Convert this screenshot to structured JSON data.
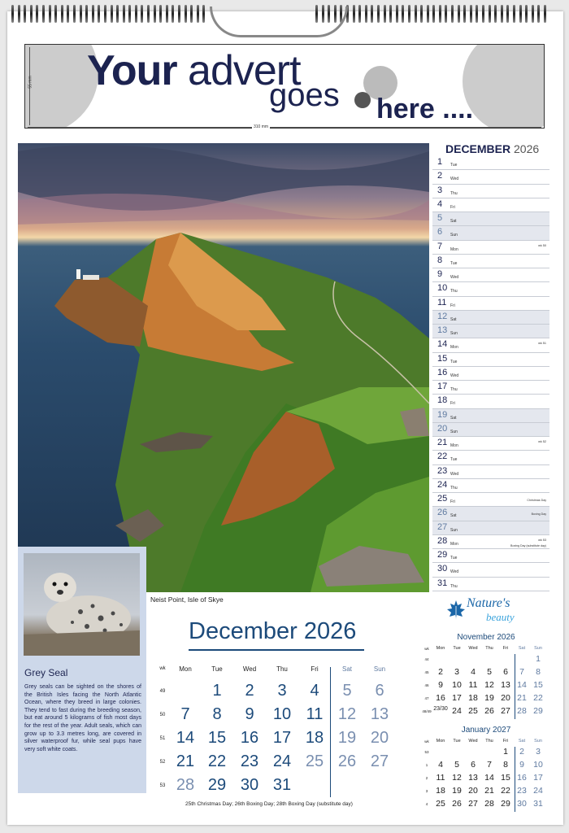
{
  "advert": {
    "line1_a": "Your",
    "line1_b": "advert",
    "line2": "goes",
    "line3": "here ....",
    "width_label": "310 mm",
    "height_label": "55 mm"
  },
  "photo": {
    "caption": "Neist Point, Isle of Skye"
  },
  "seal": {
    "title": "Grey Seal",
    "text": "Grey seals can be sighted on the shores of the British Isles facing the North Atlantic Ocean, where they breed in large colonies. They tend to fast during the breeding season, but eat around 5 kilograms of fish most days for the rest of the year. Adult seals, which can grow up to 3.3 metres long, are covered in silver waterproof fur, while seal pups have very soft white coats."
  },
  "daylist": {
    "month": "DECEMBER",
    "year": "2026",
    "days": [
      {
        "n": "1",
        "w": "Tue",
        "we": false
      },
      {
        "n": "2",
        "w": "Wed",
        "we": false
      },
      {
        "n": "3",
        "w": "Thu",
        "we": false
      },
      {
        "n": "4",
        "w": "Fri",
        "we": false
      },
      {
        "n": "5",
        "w": "Sat",
        "we": true
      },
      {
        "n": "6",
        "w": "Sun",
        "we": true
      },
      {
        "n": "7",
        "w": "Mon",
        "we": false,
        "wk": "wk 50"
      },
      {
        "n": "8",
        "w": "Tue",
        "we": false
      },
      {
        "n": "9",
        "w": "Wed",
        "we": false
      },
      {
        "n": "10",
        "w": "Thu",
        "we": false
      },
      {
        "n": "11",
        "w": "Fri",
        "we": false
      },
      {
        "n": "12",
        "w": "Sat",
        "we": true
      },
      {
        "n": "13",
        "w": "Sun",
        "we": true
      },
      {
        "n": "14",
        "w": "Mon",
        "we": false,
        "wk": "wk 51"
      },
      {
        "n": "15",
        "w": "Tue",
        "we": false
      },
      {
        "n": "16",
        "w": "Wed",
        "we": false
      },
      {
        "n": "17",
        "w": "Thu",
        "we": false
      },
      {
        "n": "18",
        "w": "Fri",
        "we": false
      },
      {
        "n": "19",
        "w": "Sat",
        "we": true
      },
      {
        "n": "20",
        "w": "Sun",
        "we": true
      },
      {
        "n": "21",
        "w": "Mon",
        "we": false,
        "wk": "wk 52"
      },
      {
        "n": "22",
        "w": "Tue",
        "we": false
      },
      {
        "n": "23",
        "w": "Wed",
        "we": false
      },
      {
        "n": "24",
        "w": "Thu",
        "we": false
      },
      {
        "n": "25",
        "w": "Fri",
        "we": false,
        "hol": "Christmas Day"
      },
      {
        "n": "26",
        "w": "Sat",
        "we": true,
        "hol": "Boxing Day"
      },
      {
        "n": "27",
        "w": "Sun",
        "we": true
      },
      {
        "n": "28",
        "w": "Mon",
        "we": false,
        "wk": "wk 53",
        "hol2": "Boxing Day (substitute day)"
      },
      {
        "n": "29",
        "w": "Tue",
        "we": false
      },
      {
        "n": "30",
        "w": "Wed",
        "we": false
      },
      {
        "n": "31",
        "w": "Thu",
        "we": false
      }
    ]
  },
  "logo": {
    "line1": "Nature's",
    "line2": "beauty",
    "colors": {
      "blue": "#1a66a8",
      "light": "#3aa3dc"
    }
  },
  "main_month": {
    "month": "December",
    "year": "2026",
    "wk_label": "wk",
    "headers": [
      "Mon",
      "Tue",
      "Wed",
      "Thu",
      "Fri",
      "Sat",
      "Sun"
    ],
    "weeks": [
      {
        "wk": "49",
        "days": [
          "",
          "1",
          "2",
          "3",
          "4",
          "5",
          "6"
        ]
      },
      {
        "wk": "50",
        "days": [
          "7",
          "8",
          "9",
          "10",
          "11",
          "12",
          "13"
        ]
      },
      {
        "wk": "51",
        "days": [
          "14",
          "15",
          "16",
          "17",
          "18",
          "19",
          "20"
        ]
      },
      {
        "wk": "52",
        "days": [
          "21",
          "22",
          "23",
          "24",
          "25",
          "26",
          "27"
        ]
      },
      {
        "wk": "53",
        "days": [
          "28",
          "29",
          "30",
          "31",
          "",
          "",
          ""
        ]
      }
    ],
    "footnote": "25th Christmas Day; 26th Boxing Day; 28th Boxing Day (substitute day)"
  },
  "mini_nov": {
    "title": "November 2026",
    "wk_label": "wk",
    "headers": [
      "Mon",
      "Tue",
      "Wed",
      "Thu",
      "Fri",
      "Sat",
      "Sun"
    ],
    "weeks": [
      {
        "wk": "44",
        "days": [
          "",
          "",
          "",
          "",
          "",
          "",
          "1"
        ]
      },
      {
        "wk": "45",
        "days": [
          "2",
          "3",
          "4",
          "5",
          "6",
          "7",
          "8"
        ]
      },
      {
        "wk": "46",
        "days": [
          "9",
          "10",
          "11",
          "12",
          "13",
          "14",
          "15"
        ]
      },
      {
        "wk": "47",
        "days": [
          "16",
          "17",
          "18",
          "19",
          "20",
          "21",
          "22"
        ]
      },
      {
        "wk": "48/49",
        "days": [
          "23/30",
          "24",
          "25",
          "26",
          "27",
          "28",
          "29"
        ]
      }
    ]
  },
  "mini_jan": {
    "title": "January 2027",
    "wk_label": "wk",
    "headers": [
      "Mon",
      "Tue",
      "Wed",
      "Thu",
      "Fri",
      "Sat",
      "Sun"
    ],
    "weeks": [
      {
        "wk": "53",
        "days": [
          "",
          "",
          "",
          "",
          "1",
          "2",
          "3"
        ]
      },
      {
        "wk": "1",
        "days": [
          "4",
          "5",
          "6",
          "7",
          "8",
          "9",
          "10"
        ]
      },
      {
        "wk": "2",
        "days": [
          "11",
          "12",
          "13",
          "14",
          "15",
          "16",
          "17"
        ]
      },
      {
        "wk": "3",
        "days": [
          "18",
          "19",
          "20",
          "21",
          "22",
          "23",
          "24"
        ]
      },
      {
        "wk": "4",
        "days": [
          "25",
          "26",
          "27",
          "28",
          "29",
          "30",
          "31"
        ]
      }
    ]
  }
}
